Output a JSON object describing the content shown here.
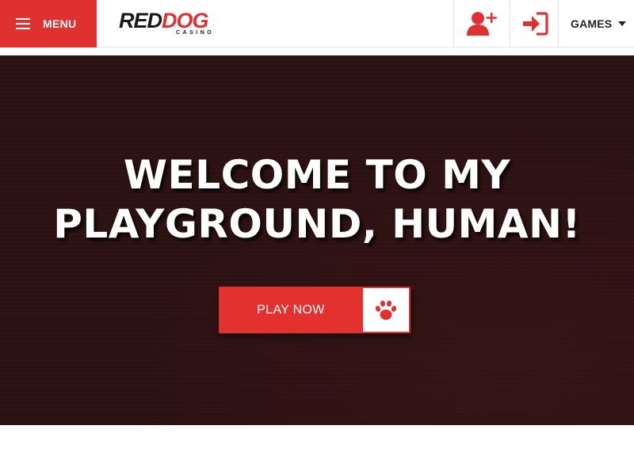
{
  "header": {
    "menu_label": "MENU",
    "logo": {
      "brand_main_a": "RED",
      "brand_main_b": "DOG",
      "brand_sub": "CASINO"
    },
    "register_icon": "user-plus-icon",
    "login_icon": "sign-in-icon",
    "games_label": "GAMES",
    "games_caret_icon": "caret-down-icon"
  },
  "hero": {
    "title": "WELCOME TO MY PLAYGROUND, HUMAN!",
    "cta_label": "PLAY NOW",
    "cta_icon": "paw-icon"
  },
  "colors": {
    "brand_red": "#e03131",
    "hero_bg": "#2c1112",
    "header_bg": "#ffffff",
    "text_dark": "#222222"
  }
}
